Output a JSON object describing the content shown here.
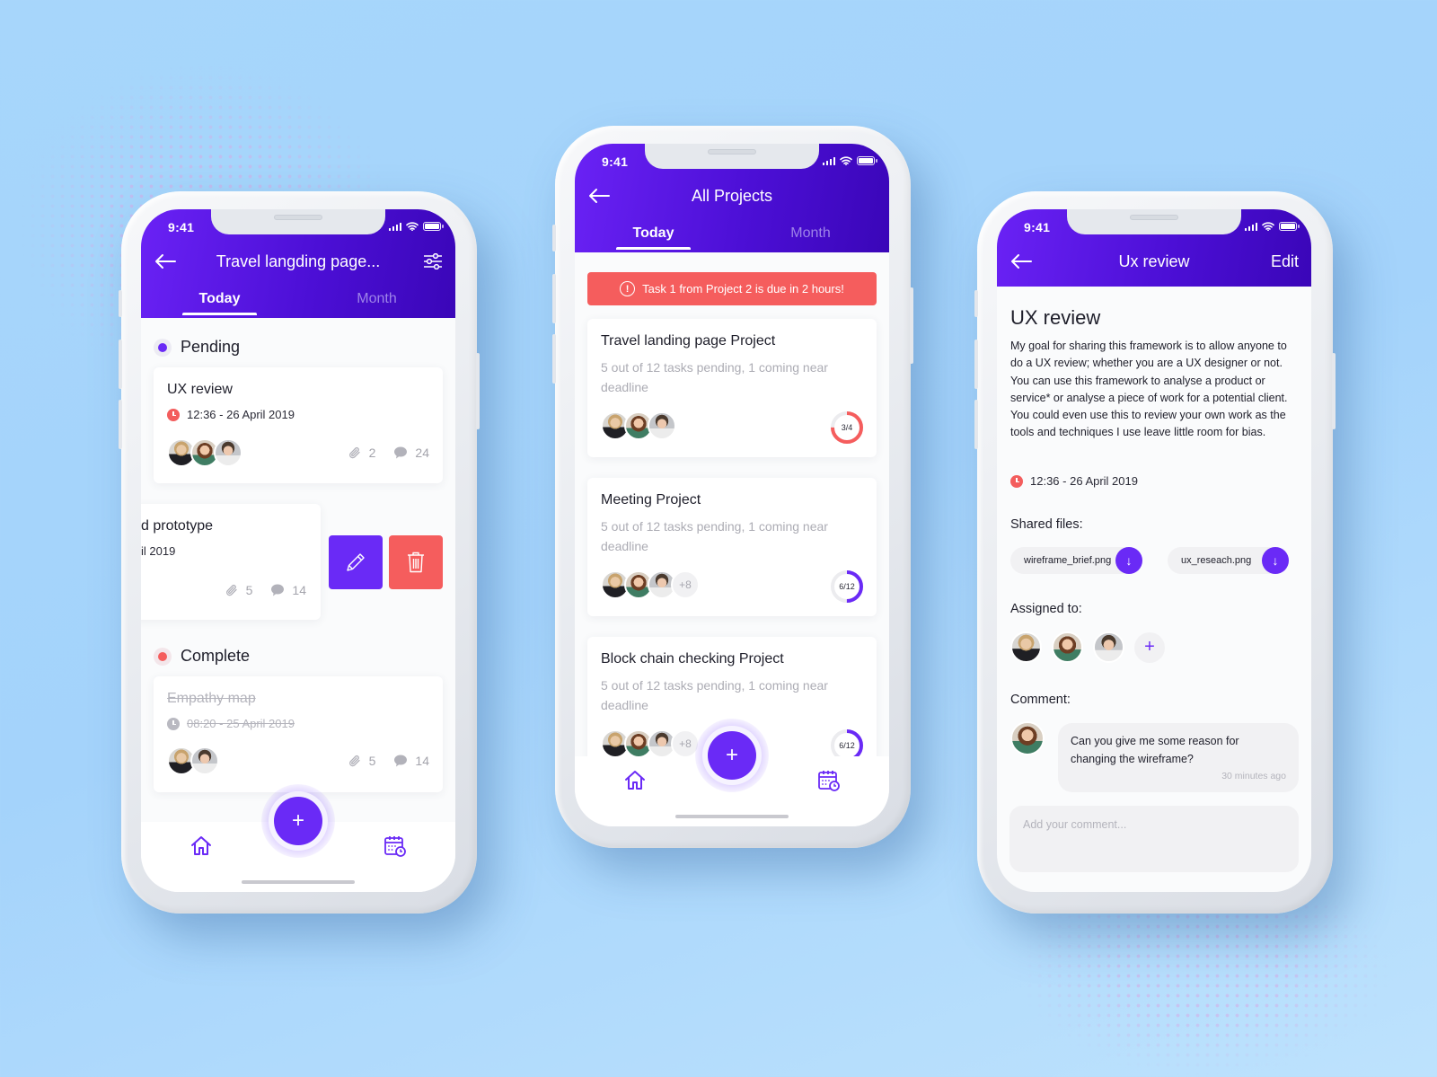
{
  "colors": {
    "primary": "#6a2af6",
    "header_gradient_start": "#6a22f5",
    "header_gradient_end": "#3a06b8",
    "danger": "#f55d5d",
    "background": "#a7d6fb"
  },
  "status_bar": {
    "time": "9:41"
  },
  "screen_tasks": {
    "title": "Travel langding page...",
    "back_icon": "arrow-left-icon",
    "filter_icon": "sliders-icon",
    "tabs": [
      {
        "label": "Today",
        "active": true
      },
      {
        "label": "Month",
        "active": false
      }
    ],
    "sections": [
      {
        "label": "Pending",
        "color": "#6a2af6",
        "tasks": [
          {
            "title": "UX review",
            "datetime": "12:36 - 26 April 2019",
            "attachments": "2",
            "comments": "24",
            "assignees": 3
          },
          {
            "title": "d prototype",
            "datetime": "il 2019",
            "attachments": "5",
            "comments": "14",
            "assignees": 0,
            "swiped": true
          }
        ]
      },
      {
        "label": "Complete",
        "color": "#f55d5d",
        "tasks": [
          {
            "title": "Empathy map",
            "datetime": "08:20 - 25 April 2019",
            "attachments": "5",
            "comments": "14",
            "assignees": 2,
            "completed": true
          }
        ]
      }
    ],
    "swipe_actions": [
      {
        "icon": "pencil-icon",
        "label": "Edit"
      },
      {
        "icon": "trash-icon",
        "label": "Delete"
      }
    ],
    "fab_label": "+",
    "bottom_nav": [
      {
        "icon": "home-icon"
      },
      {
        "icon": "calendar-clock-icon"
      }
    ]
  },
  "screen_projects": {
    "title": "All Projects",
    "back_icon": "arrow-left-icon",
    "tabs": [
      {
        "label": "Today",
        "active": true
      },
      {
        "label": "Month",
        "active": false
      }
    ],
    "alert": {
      "icon": "alert-circle-icon",
      "icon_glyph": "!",
      "text": "Task 1 from Project 2 is due in 2 hours!"
    },
    "projects": [
      {
        "title": "Travel landing page Project",
        "subtitle": "5 out of 12 tasks pending, 1 coming near deadline",
        "extra_members": "",
        "progress_label": "3/4",
        "progress": 0.75,
        "progress_color": "#f55d5d"
      },
      {
        "title": "Meeting Project",
        "subtitle": "5 out of 12 tasks pending, 1 coming near deadline",
        "extra_members": "+8",
        "progress_label": "6/12",
        "progress": 0.5,
        "progress_color": "#6a2af6"
      },
      {
        "title": "Block chain checking Project",
        "subtitle": "5 out of 12 tasks pending, 1 coming near deadline",
        "extra_members": "+8",
        "progress_label": "6/12",
        "progress": 0.5,
        "progress_color": "#6a2af6"
      }
    ],
    "fab_label": "+",
    "bottom_nav": [
      {
        "icon": "home-icon"
      },
      {
        "icon": "calendar-clock-icon"
      }
    ]
  },
  "screen_detail": {
    "title": "Ux review",
    "edit_label": "Edit",
    "back_icon": "arrow-left-icon",
    "heading": "UX review",
    "description": "My goal for sharing this framework is to allow anyone to do a UX review; whether you are a UX designer or not. You can use this framework to analyse a product or service* or analyse a piece of work for a potential client. You could even use this to review your own work as the tools and techniques I use leave little room for bias.",
    "datetime": "12:36 - 26 April 2019",
    "shared_files_label": "Shared files:",
    "files": [
      {
        "name": "wireframe_brief.png",
        "icon": "download-icon",
        "glyph": "↓"
      },
      {
        "name": "ux_reseach.png",
        "icon": "download-icon",
        "glyph": "↓"
      }
    ],
    "assigned_label": "Assigned to:",
    "add_assignee_label": "+",
    "comment_label": "Comment:",
    "comments": [
      {
        "text": "Can you give me some reason for changing the wireframe?",
        "time": "30 minutes ago"
      }
    ],
    "comment_placeholder": "Add your comment..."
  }
}
